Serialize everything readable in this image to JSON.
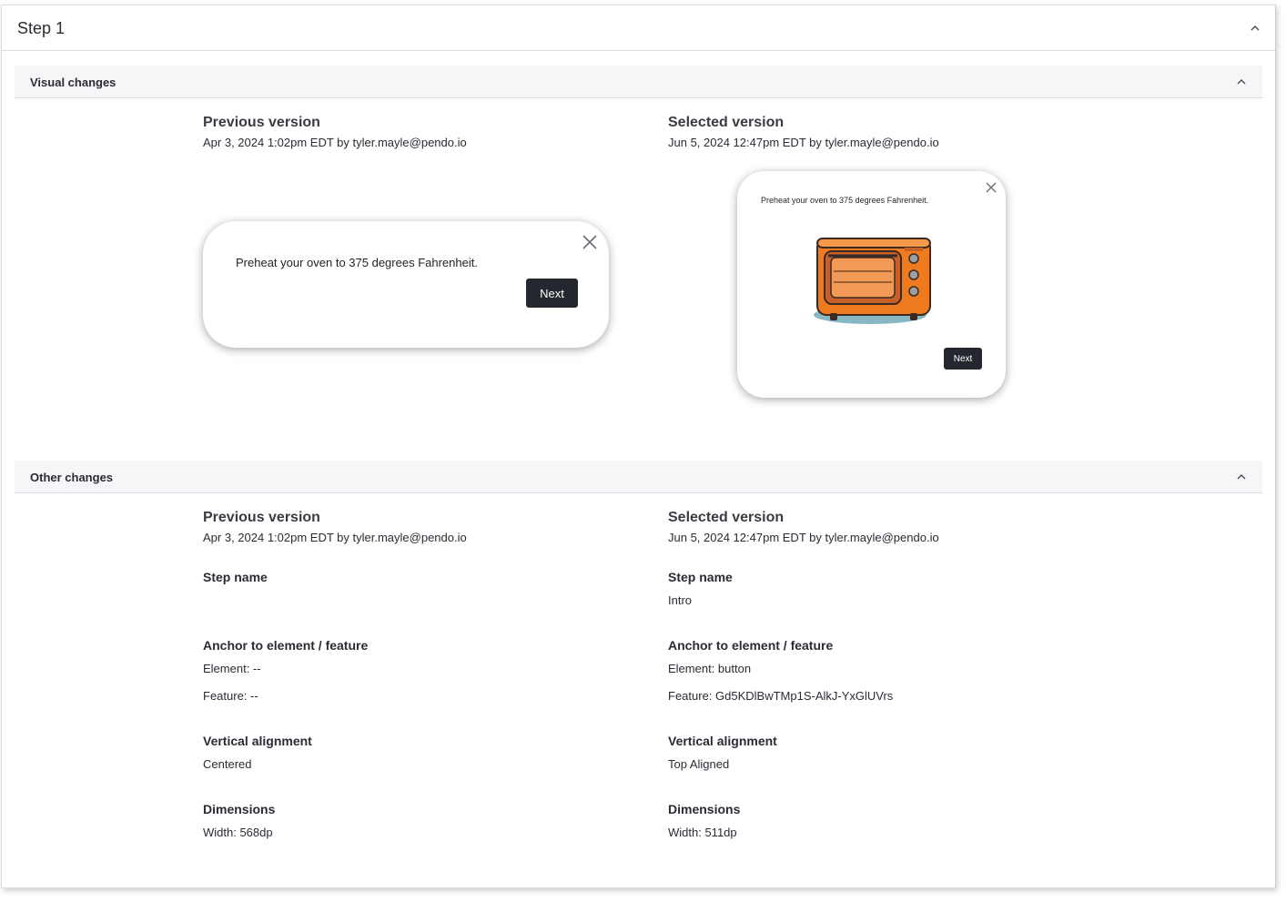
{
  "step": {
    "title": "Step 1"
  },
  "visual_changes": {
    "title": "Visual changes",
    "previous": {
      "heading": "Previous version",
      "meta": "Apr 3, 2024 1:02pm EDT by tyler.mayle@pendo.io",
      "guide_text": "Preheat your oven to 375 degrees Fahrenheit.",
      "button_label": "Next"
    },
    "selected": {
      "heading": "Selected version",
      "meta": "Jun 5, 2024 12:47pm EDT by tyler.mayle@pendo.io",
      "guide_text": "Preheat your oven to 375 degrees Fahrenheit.",
      "button_label": "Next",
      "image": "toaster-oven-illustration"
    }
  },
  "other_changes": {
    "title": "Other changes",
    "previous": {
      "heading": "Previous version",
      "meta": "Apr 3, 2024 1:02pm EDT by tyler.mayle@pendo.io",
      "step_name_label": "Step name",
      "step_name_value": "",
      "anchor_label": "Anchor to element / feature",
      "element": "Element: --",
      "feature": "Feature: --",
      "vertical_label": "Vertical alignment",
      "vertical_value": "Centered",
      "dimensions_label": "Dimensions",
      "width": "Width: 568dp"
    },
    "selected": {
      "heading": "Selected version",
      "meta": "Jun 5, 2024 12:47pm EDT by tyler.mayle@pendo.io",
      "step_name_label": "Step name",
      "step_name_value": "Intro",
      "anchor_label": "Anchor to element / feature",
      "element": "Element: button",
      "feature": "Feature: Gd5KDlBwTMp1S-AlkJ-YxGlUVrs",
      "vertical_label": "Vertical alignment",
      "vertical_value": "Top Aligned",
      "dimensions_label": "Dimensions",
      "width": "Width: 511dp"
    }
  },
  "icons": {
    "collapse": "chevron-up-icon",
    "close": "close-icon"
  },
  "colors": {
    "button_bg": "#25272e",
    "section_bg": "#f6f6f8",
    "border": "#dadce5",
    "oven_orange": "#f07a1e"
  }
}
